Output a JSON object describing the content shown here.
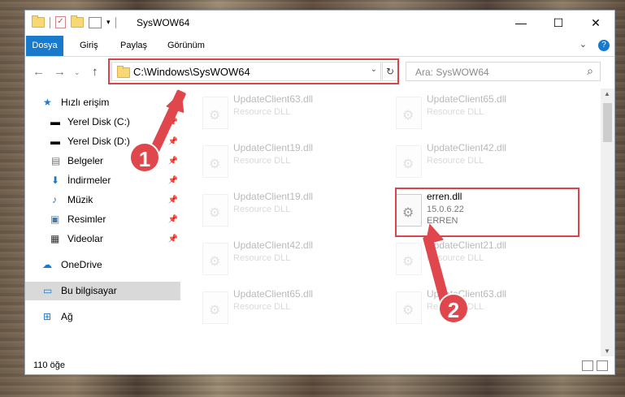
{
  "window": {
    "title": "SysWOW64"
  },
  "ribbon": {
    "tabs": [
      {
        "label": "Dosya"
      },
      {
        "label": "Giriş"
      },
      {
        "label": "Paylaş"
      },
      {
        "label": "Görünüm"
      }
    ]
  },
  "nav": {
    "address": "C:\\Windows\\SysWOW64",
    "search_placeholder": "Ara: SysWOW64"
  },
  "sidebar": {
    "items": [
      {
        "label": "Hızlı erişim",
        "icon": "star-icon",
        "pinned": false
      },
      {
        "label": "Yerel Disk (C:)",
        "icon": "drive-icon",
        "pinned": true
      },
      {
        "label": "Yerel Disk (D:)",
        "icon": "drive-icon",
        "pinned": true
      },
      {
        "label": "Belgeler",
        "icon": "document-icon",
        "pinned": true
      },
      {
        "label": "İndirmeler",
        "icon": "download-icon",
        "pinned": true
      },
      {
        "label": "Müzik",
        "icon": "music-icon",
        "pinned": true
      },
      {
        "label": "Resimler",
        "icon": "pictures-icon",
        "pinned": true
      },
      {
        "label": "Videolar",
        "icon": "video-icon",
        "pinned": true
      },
      {
        "label": "OneDrive",
        "icon": "cloud-icon",
        "pinned": false
      },
      {
        "label": "Bu bilgisayar",
        "icon": "computer-icon",
        "pinned": false
      },
      {
        "label": "Ağ",
        "icon": "network-icon",
        "pinned": false
      }
    ]
  },
  "files": [
    {
      "name": "UpdateClient63.dll",
      "desc": "Resource DLL"
    },
    {
      "name": "UpdateClient65.dll",
      "desc": "Resource DLL"
    },
    {
      "name": "UpdateClient19.dll",
      "desc": "Resource DLL"
    },
    {
      "name": "UpdateClient42.dll",
      "desc": "Resource DLL"
    },
    {
      "name": "UpdateClient19.dll",
      "desc": "Resource DLL"
    },
    {
      "name": "erren.dll",
      "version": "15.0.6.22",
      "desc": "ERREN"
    },
    {
      "name": "UpdateClient42.dll",
      "desc": "Resource DLL"
    },
    {
      "name": "UpdateClient21.dll",
      "desc": "Resource DLL"
    },
    {
      "name": "UpdateClient65.dll",
      "desc": "Resource DLL"
    },
    {
      "name": "UpdateClient63.dll",
      "desc": "Resource DLL"
    }
  ],
  "status": {
    "count": "110 öğe"
  },
  "annotations": {
    "badge1": "1",
    "badge2": "2"
  },
  "colors": {
    "highlight": "#d9444a",
    "accent": "#1979ca"
  }
}
